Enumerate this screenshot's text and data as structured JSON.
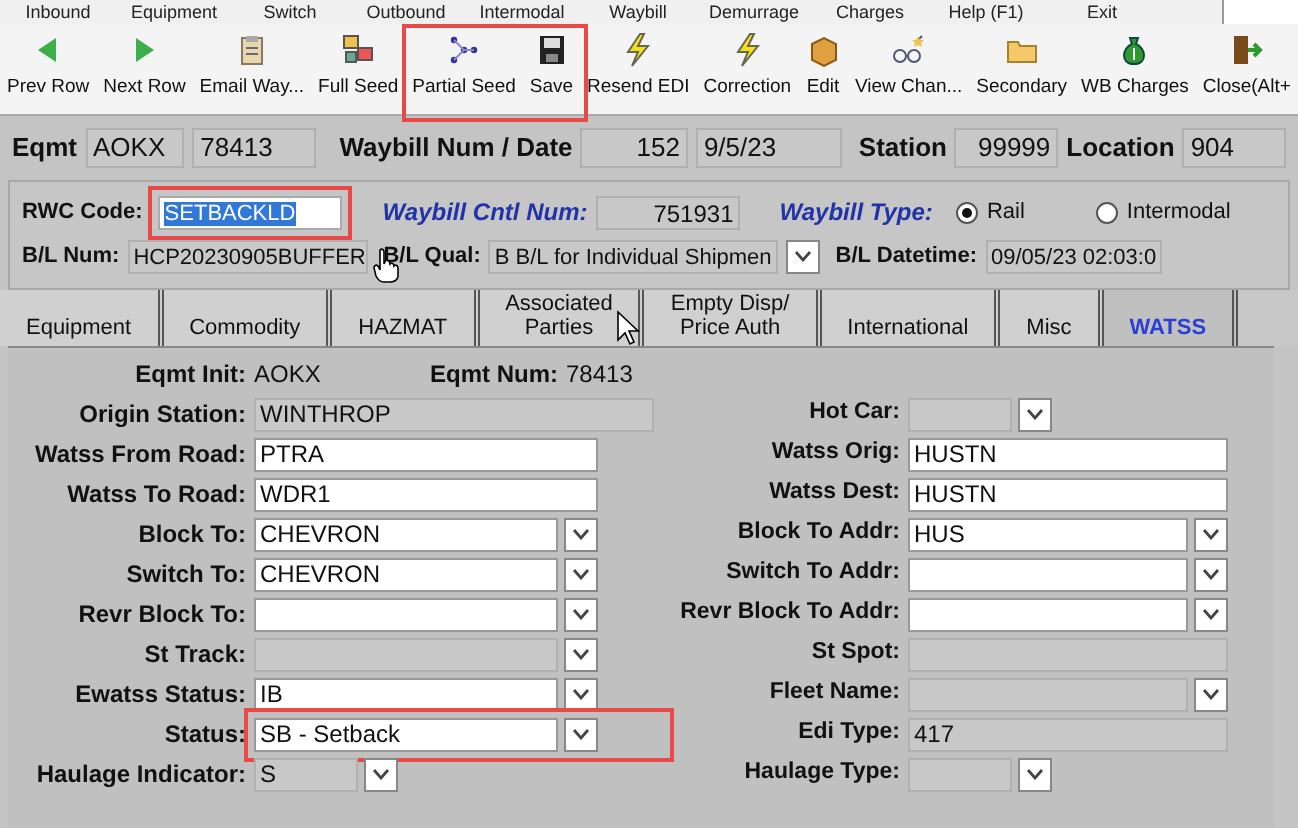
{
  "menu": [
    "Inbound",
    "Equipment",
    "Switch",
    "Outbound",
    "Intermodal",
    "Waybill",
    "Demurrage",
    "Charges",
    "Help (F1)",
    "Exit"
  ],
  "toolbar": [
    {
      "label": "Prev Row",
      "kind": "prev",
      "highlighted": false
    },
    {
      "label": "Next Row",
      "kind": "next",
      "highlighted": false
    },
    {
      "label": "Email Way...",
      "kind": "clipboard",
      "highlighted": false
    },
    {
      "label": "Full Seed",
      "kind": "seed",
      "highlighted": false
    },
    {
      "label": "Partial Seed",
      "kind": "partial",
      "highlighted": true
    },
    {
      "label": "Save",
      "kind": "save",
      "highlighted": true
    },
    {
      "label": "Resend EDI",
      "kind": "bolt",
      "highlighted": false
    },
    {
      "label": "Correction",
      "kind": "bolt",
      "highlighted": false
    },
    {
      "label": "Edit",
      "kind": "box",
      "highlighted": false
    },
    {
      "label": "View Chan...",
      "kind": "glasses",
      "highlighted": false
    },
    {
      "label": "Secondary",
      "kind": "folder",
      "highlighted": false
    },
    {
      "label": "WB Charges",
      "kind": "money",
      "highlighted": false
    },
    {
      "label": "Close(Alt+",
      "kind": "door",
      "highlighted": false
    }
  ],
  "header": {
    "eqmt_label": "Eqmt",
    "eqmt_init": "AOKX",
    "eqmt_num": "78413",
    "waybill_label": "Waybill Num / Date",
    "waybill_num": "152",
    "waybill_date": "9/5/23",
    "station_label": "Station",
    "station": "99999",
    "location_label": "Location",
    "location": "904"
  },
  "rwc": {
    "code_label": "RWC Code:",
    "code": "SETBACKLD",
    "code_highlighted": true,
    "cntl_label": "Waybill Cntl Num:",
    "cntl": "751931",
    "type_label": "Waybill Type:",
    "types": [
      {
        "label": "Rail",
        "selected": true
      },
      {
        "label": "Intermodal",
        "selected": false
      }
    ],
    "bl_num_label": "B/L Num:",
    "bl_num": "HCP20230905BUFFER",
    "bl_qual_label": "B/L Qual:",
    "bl_qual": "B B/L for Individual Shipmen",
    "bl_datetime_label": "B/L Datetime:",
    "bl_datetime": "09/05/23 02:03:0"
  },
  "tabs": [
    {
      "label": "Equipment",
      "selected": false
    },
    {
      "label": "Commodity",
      "selected": false
    },
    {
      "label": "HAZMAT",
      "selected": false
    },
    {
      "label": "Associated\nParties",
      "selected": false
    },
    {
      "label": "Empty Disp/\nPrice Auth",
      "selected": false
    },
    {
      "label": "International",
      "selected": false
    },
    {
      "label": "Misc",
      "selected": false
    },
    {
      "label": "WATSS",
      "selected": true
    }
  ],
  "watss": {
    "eqmt_init_label": "Eqmt Init:",
    "eqmt_init": "AOKX",
    "eqmt_num_label": "Eqmt Num:",
    "eqmt_num": "78413",
    "rows": [
      {
        "left": {
          "label": "Origin Station:",
          "value": "WINTHROP",
          "kind": "readonly_wide"
        },
        "right": {
          "label": "Hot Car:",
          "kind": "short_select_ro"
        }
      },
      {
        "left": {
          "label": "Watss From Road:",
          "value": "PTRA",
          "kind": "text"
        },
        "right": {
          "label": "Watss Orig:",
          "value": "HUSTN",
          "kind": "text"
        }
      },
      {
        "left": {
          "label": "Watss To Road:",
          "value": "WDR1",
          "kind": "text"
        },
        "right": {
          "label": "Watss Dest:",
          "value": "HUSTN",
          "kind": "text"
        }
      },
      {
        "left": {
          "label": "Block To:",
          "value": "CHEVRON",
          "kind": "select"
        },
        "right": {
          "label": "Block To Addr:",
          "value": "HUS",
          "kind": "select"
        }
      },
      {
        "left": {
          "label": "Switch To:",
          "value": "CHEVRON",
          "kind": "select"
        },
        "right": {
          "label": "Switch To Addr:",
          "kind": "select"
        }
      },
      {
        "left": {
          "label": "Revr Block To:",
          "kind": "select"
        },
        "right": {
          "label": "Revr Block To Addr:",
          "kind": "select"
        }
      },
      {
        "left": {
          "label": "St Track:",
          "kind": "select_ro"
        },
        "right": {
          "label": "St Spot:",
          "kind": "readonly"
        }
      },
      {
        "left": {
          "label": "Ewatss Status:",
          "value": "IB",
          "kind": "select"
        },
        "right": {
          "label": "Fleet Name:",
          "kind": "select_ro"
        }
      },
      {
        "left": {
          "label": "Status:",
          "value": "SB - Setback",
          "kind": "select",
          "highlighted": true
        },
        "right": {
          "label": "Edi Type:",
          "value": "417",
          "kind": "readonly"
        }
      },
      {
        "left": {
          "label": "Haulage Indicator:",
          "value": "S",
          "kind": "short_select_ro"
        },
        "right": {
          "label": "Haulage Type:",
          "kind": "short_select_ro"
        }
      }
    ]
  }
}
